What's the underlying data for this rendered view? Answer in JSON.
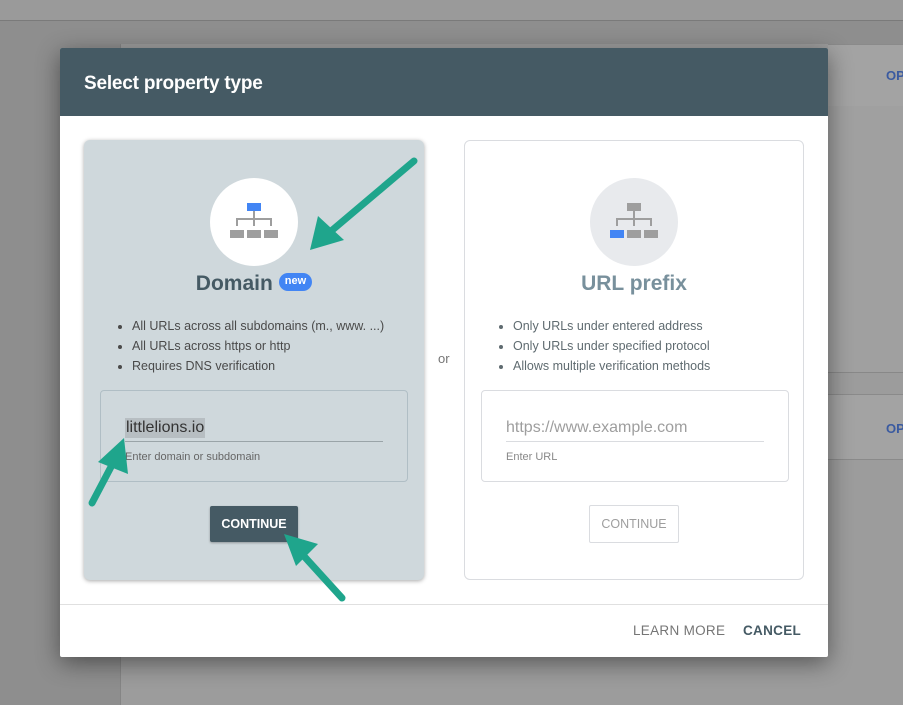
{
  "background": {
    "link_top": "OP",
    "link_bottom": "OP"
  },
  "dialog": {
    "title": "Select property type",
    "separator": "or",
    "footer": {
      "learn_more": "LEARN MORE",
      "cancel": "CANCEL"
    }
  },
  "domain_card": {
    "title": "Domain",
    "badge": "new",
    "bullets": [
      "All URLs across all subdomains (m., www. ...)",
      "All URLs across https or http",
      "Requires DNS verification"
    ],
    "input_value": "littlelions.io",
    "input_helper": "Enter domain or subdomain",
    "continue_label": "CONTINUE",
    "icon": "sitemap-icon"
  },
  "url_card": {
    "title": "URL prefix",
    "bullets": [
      "Only URLs under entered address",
      "Only URLs under specified protocol",
      "Allows multiple verification methods"
    ],
    "input_placeholder": "https://www.example.com",
    "input_helper": "Enter URL",
    "continue_label": "CONTINUE",
    "icon": "sitemap-icon"
  },
  "colors": {
    "header": "#455a64",
    "selected_card": "#cfd8dc",
    "accent_blue": "#4285f4",
    "annotation_arrow": "#1fa58c"
  }
}
